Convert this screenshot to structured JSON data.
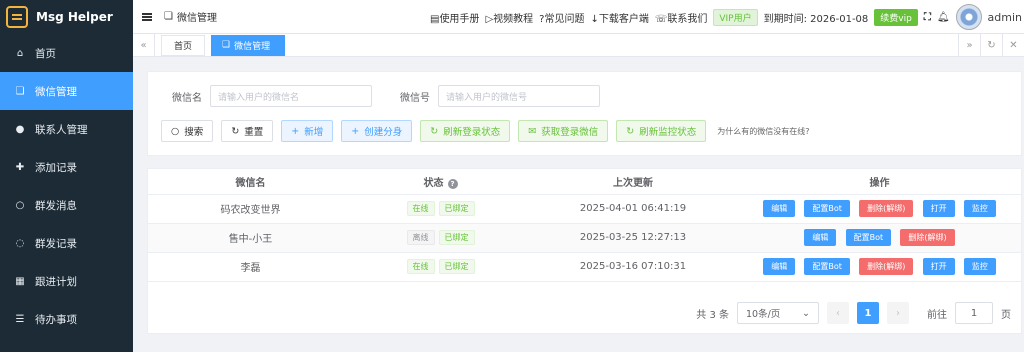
{
  "app": {
    "name": "Msg Helper"
  },
  "sidebar": {
    "items": [
      {
        "label": "首页",
        "icon": "home-icon"
      },
      {
        "label": "微信管理",
        "icon": "wechat-icon",
        "active": true
      },
      {
        "label": "联系人管理",
        "icon": "user-icon"
      },
      {
        "label": "添加记录",
        "icon": "user-add-icon"
      },
      {
        "label": "群发消息",
        "icon": "chat-icon"
      },
      {
        "label": "群发记录",
        "icon": "chat-record-icon"
      },
      {
        "label": "跟进计划",
        "icon": "calendar-icon"
      },
      {
        "label": "待办事项",
        "icon": "todo-icon"
      }
    ]
  },
  "topbar": {
    "breadcrumb": "微信管理",
    "links": [
      "使用手册",
      "视频教程",
      "常见问题",
      "下载客户端",
      "联系我们"
    ],
    "vip_tag": "VIP用户",
    "expiry": "到期时间: 2026-01-08",
    "renew_label": "续费vip",
    "username": "admin"
  },
  "tabs": [
    {
      "label": "首页"
    },
    {
      "label": "微信管理",
      "active": true
    }
  ],
  "search": {
    "name_label": "微信名",
    "name_placeholder": "请输入用户的微信名",
    "id_label": "微信号",
    "id_placeholder": "请输入用户的微信号",
    "buttons": {
      "search": "搜索",
      "reset": "重置",
      "add": "新增",
      "clone": "创建分身",
      "refresh_login": "刷新登录状态",
      "get_login": "获取登录微信",
      "refresh_monitor": "刷新监控状态"
    },
    "help_text": "为什么有的微信没有在线?"
  },
  "table": {
    "columns": [
      "微信名",
      "状态",
      "上次更新",
      "操作"
    ],
    "rows": [
      {
        "name": "码农改变世界",
        "online": "在线",
        "bound": "已绑定",
        "updated": "2025-04-01 06:41:19",
        "online_state": "online"
      },
      {
        "name": "售中-小王",
        "online": "离线",
        "bound": "已绑定",
        "updated": "2025-03-25 12:27:13",
        "online_state": "offline"
      },
      {
        "name": "李磊",
        "online": "在线",
        "bound": "已绑定",
        "updated": "2025-03-16 07:10:31",
        "online_state": "online"
      }
    ],
    "actions": {
      "edit": "编辑",
      "bot": "配置Bot",
      "delete": "删除(解绑)",
      "open": "打开",
      "monitor": "监控"
    }
  },
  "pagination": {
    "total": "共 3 条",
    "page_size": "10条/页",
    "current_page": "1",
    "goto_label": "前往",
    "goto_value": "1",
    "page_suffix": "页"
  },
  "colors": {
    "primary": "#409eff",
    "success": "#67c23a",
    "danger": "#f56c6c",
    "sidebar_bg": "#1c2b36"
  }
}
